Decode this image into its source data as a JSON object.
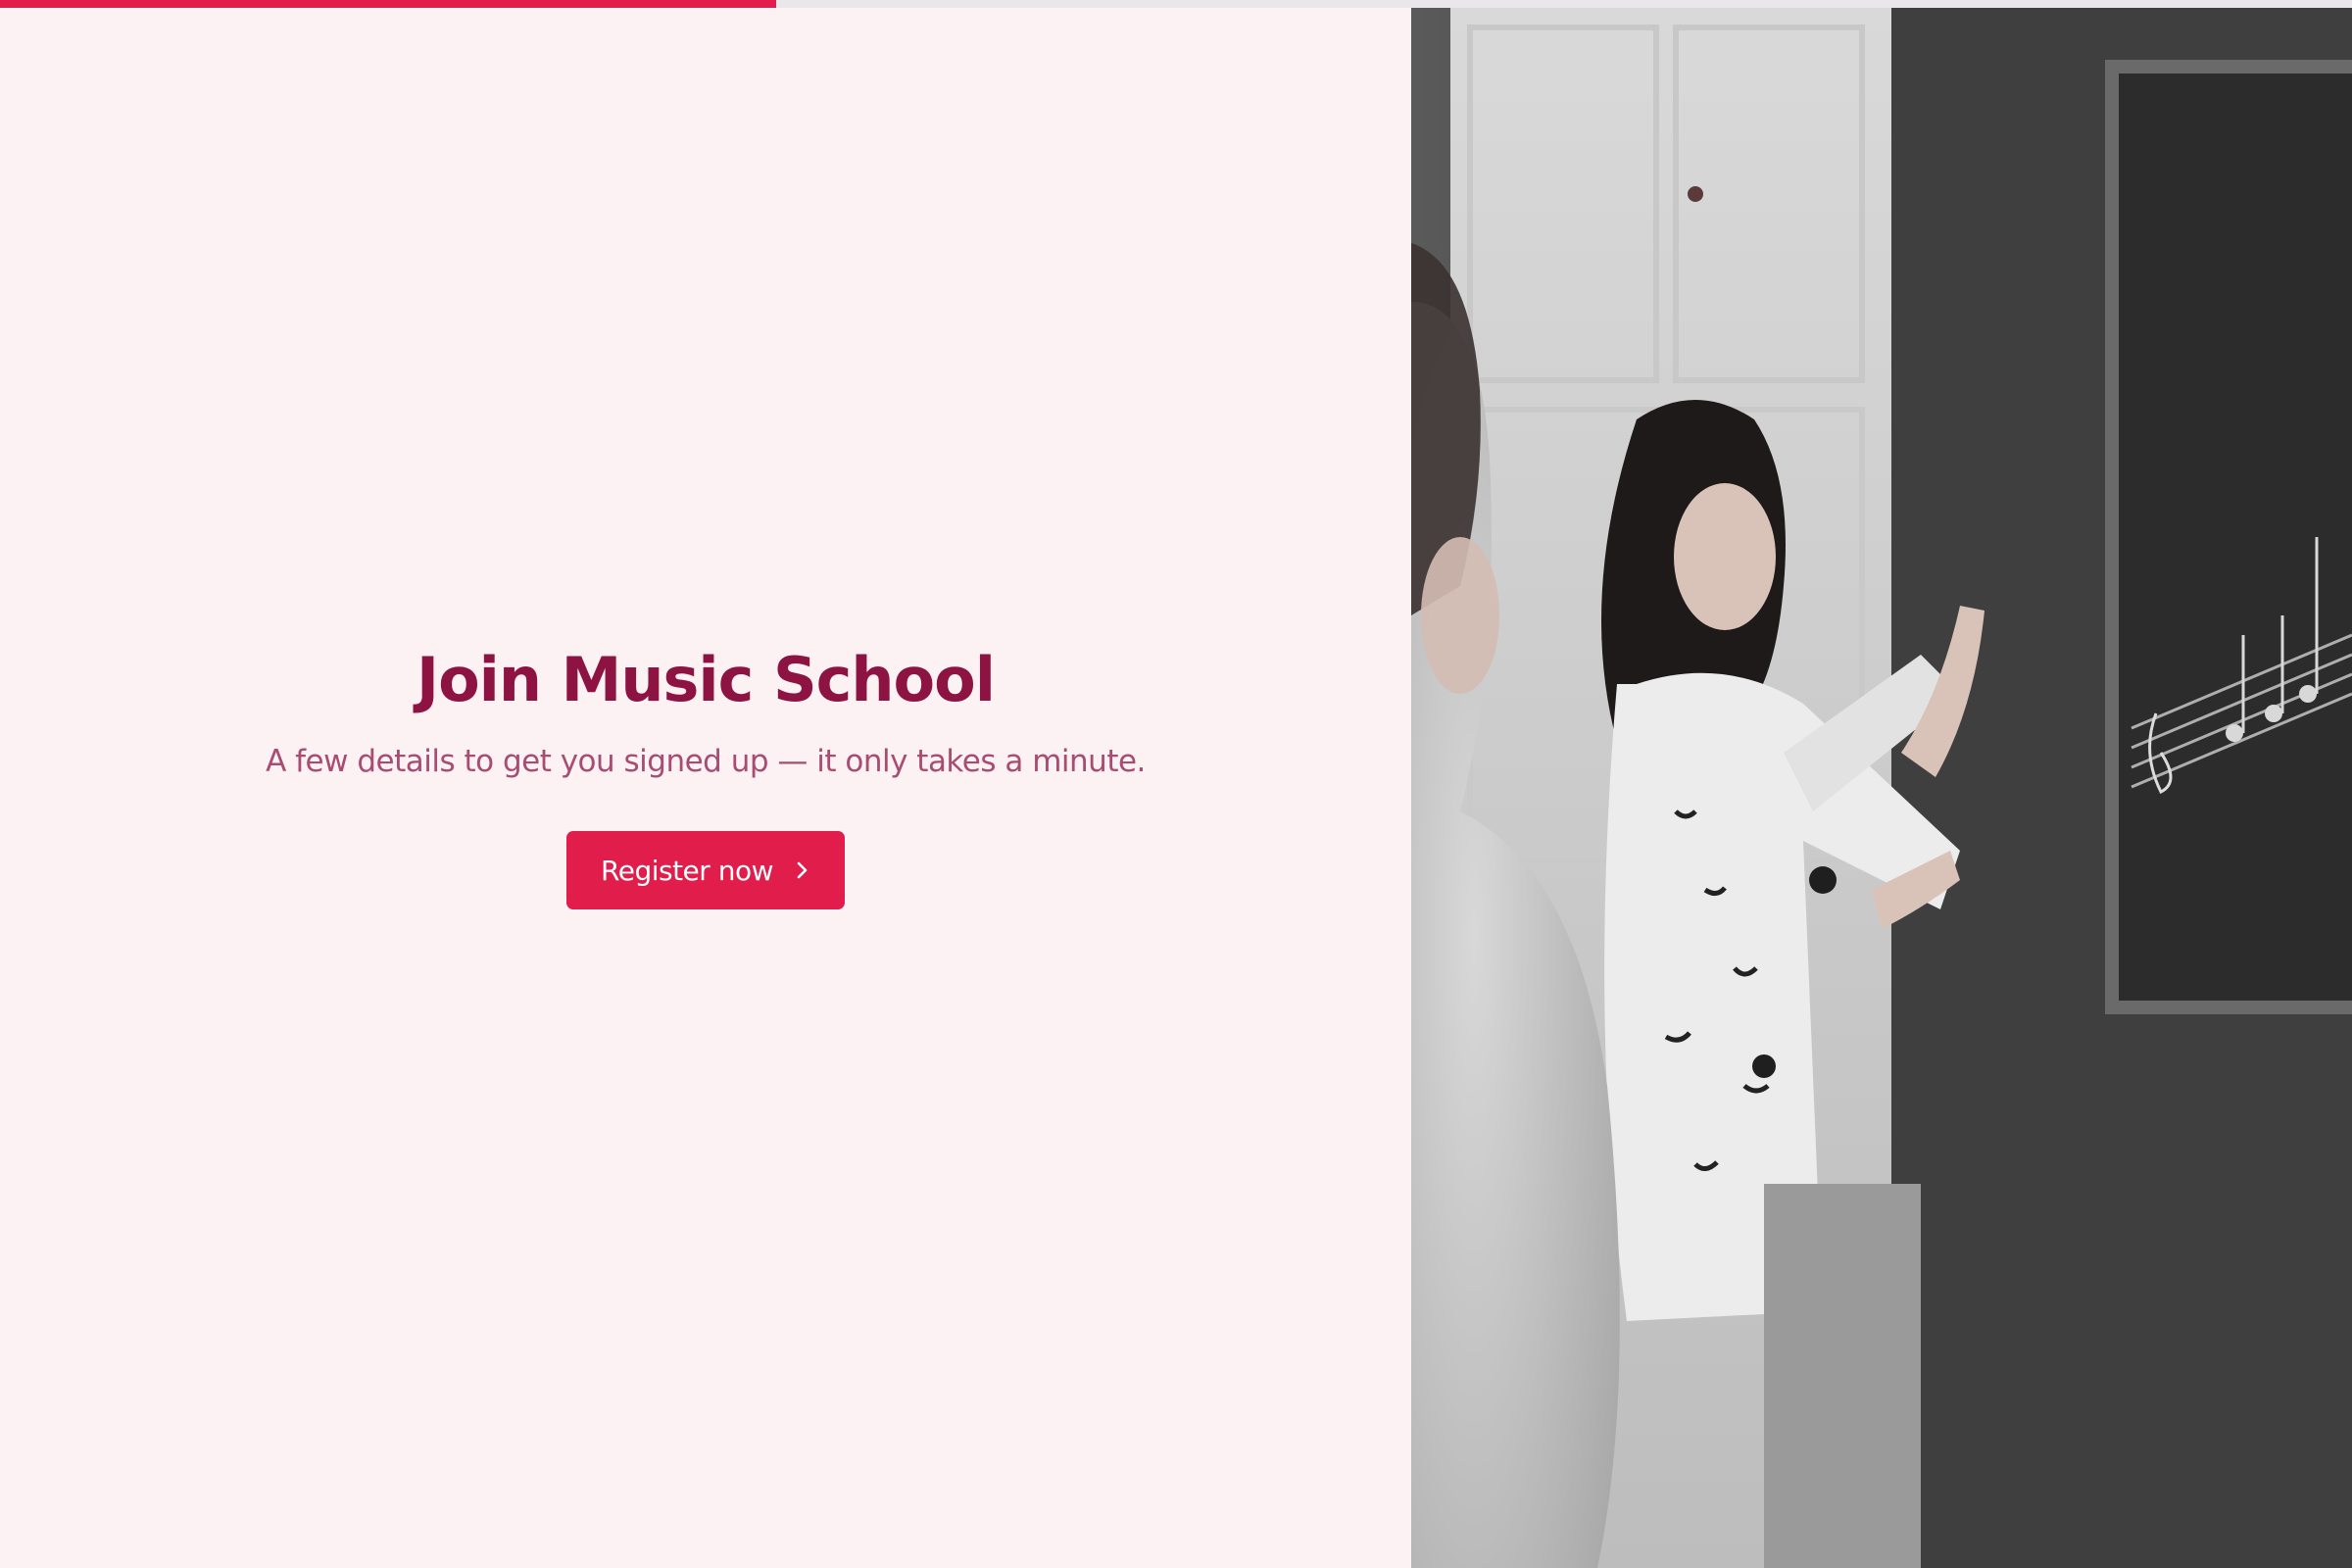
{
  "progress": {
    "fraction": 0.33,
    "fill_color": "#e01d4b",
    "track_color": "#e9e7ea"
  },
  "hero": {
    "title": "Join Music School",
    "subtitle": "A few details to get you signed up — it only takes a minute.",
    "cta_label": "Register now",
    "cta_icon": "chevron-right-icon"
  },
  "colors": {
    "background": "#fdf2f3",
    "accent": "#e01d4b",
    "title": "#8c1342",
    "subtitle": "#a84c72"
  }
}
